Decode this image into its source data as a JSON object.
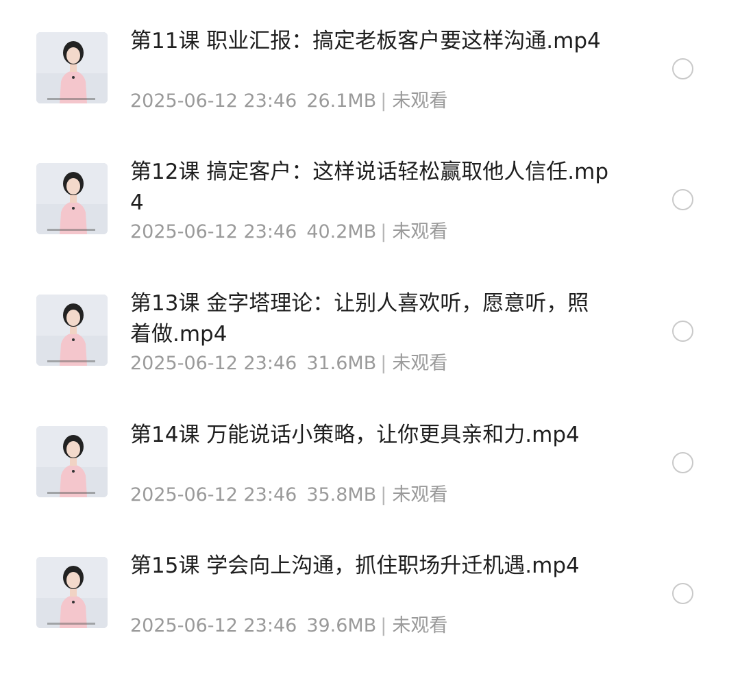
{
  "files": [
    {
      "name": "第11课 职业汇报：搞定老板客户要这样沟通.mp4",
      "date": "2025-06-12 23:46",
      "size": "26.1MB",
      "status": "未观看",
      "selected": false,
      "thumbnail_icon": "video-thumbnail-icon"
    },
    {
      "name": "第12课 搞定客户：这样说话轻松赢取他人信任.mp4",
      "date": "2025-06-12 23:46",
      "size": "40.2MB",
      "status": "未观看",
      "selected": false,
      "thumbnail_icon": "video-thumbnail-icon"
    },
    {
      "name": "第13课 金字塔理论：让别人喜欢听，愿意听，照着做.mp4",
      "date": "2025-06-12 23:46",
      "size": "31.6MB",
      "status": "未观看",
      "selected": false,
      "thumbnail_icon": "video-thumbnail-icon"
    },
    {
      "name": "第14课 万能说话小策略，让你更具亲和力.mp4",
      "date": "2025-06-12 23:46",
      "size": "35.8MB",
      "status": "未观看",
      "selected": false,
      "thumbnail_icon": "video-thumbnail-icon"
    },
    {
      "name": "第15课 学会向上沟通，抓住职场升迁机遇.mp4",
      "date": "2025-06-12 23:46",
      "size": "39.6MB",
      "status": "未观看",
      "selected": false,
      "thumbnail_icon": "video-thumbnail-icon"
    }
  ],
  "meta_separator": "|",
  "colors": {
    "title_text": "#1e1e1e",
    "meta_text": "#9a9a9a",
    "radio_border": "#c9c9c9",
    "thumbnail_background": "#dfe3ea",
    "thumbnail_blouse": "#f4c6cc"
  }
}
